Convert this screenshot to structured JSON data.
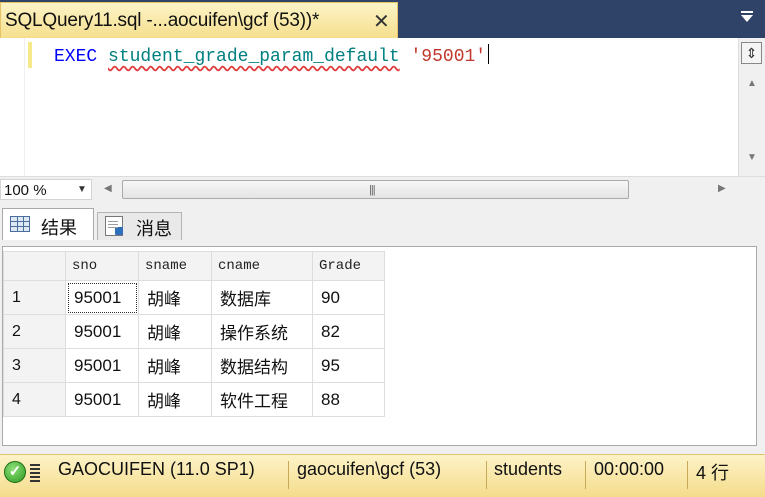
{
  "tab": {
    "title": "SQLQuery11.sql -...aocuifen\\gcf (53))*",
    "close_glyph": "✕"
  },
  "editor": {
    "keyword": "EXEC",
    "procedure": "student_grade_param_default",
    "argument": "'95001'"
  },
  "zoom": {
    "value": "100 %"
  },
  "result_tabs": [
    {
      "label": "结果",
      "icon": "grid-icon",
      "active": true
    },
    {
      "label": "消息",
      "icon": "messages-icon",
      "active": false
    }
  ],
  "results": {
    "columns": [
      "sno",
      "sname",
      "cname",
      "Grade"
    ],
    "rows": [
      {
        "num": "1",
        "sno": "95001",
        "sname": "胡峰",
        "cname": "数据库",
        "grade": "90"
      },
      {
        "num": "2",
        "sno": "95001",
        "sname": "胡峰",
        "cname": "操作系统",
        "grade": "82"
      },
      {
        "num": "3",
        "sno": "95001",
        "sname": "胡峰",
        "cname": "数据结构",
        "grade": "95"
      },
      {
        "num": "4",
        "sno": "95001",
        "sname": "胡峰",
        "cname": "软件工程",
        "grade": "88"
      }
    ]
  },
  "status": {
    "server": "GAOCUIFEN (11.0 SP1)",
    "connection": "gaocuifen\\gcf (53)",
    "database": "students",
    "elapsed": "00:00:00",
    "rows": "4 行"
  },
  "colors": {
    "accent_status": "#f4dc8a",
    "keyword": "#0000ff",
    "identifier": "#008080",
    "string": "#c0382b"
  }
}
